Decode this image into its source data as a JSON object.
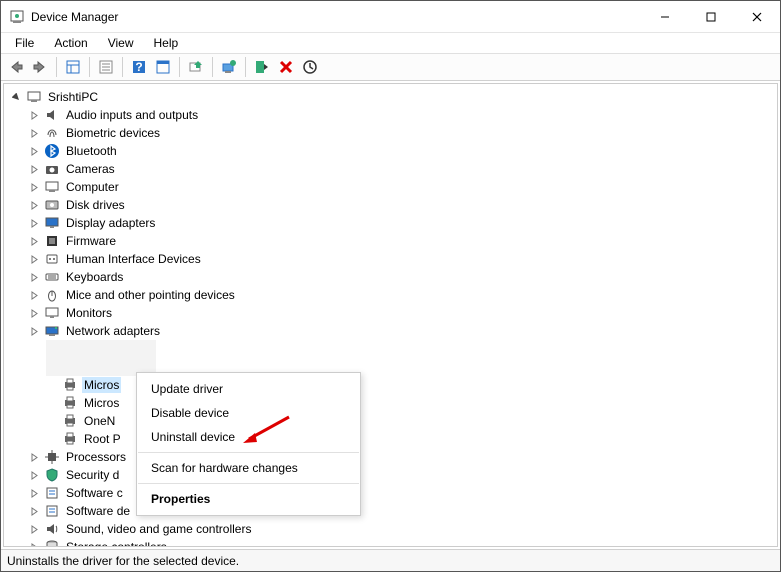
{
  "window": {
    "title": "Device Manager"
  },
  "menus": {
    "file": "File",
    "action": "Action",
    "view": "View",
    "help": "Help"
  },
  "root": {
    "name": "SrishtiPC"
  },
  "categories": [
    {
      "label": "Audio inputs and outputs",
      "icon": "speaker"
    },
    {
      "label": "Biometric devices",
      "icon": "fingerprint"
    },
    {
      "label": "Bluetooth",
      "icon": "bluetooth"
    },
    {
      "label": "Cameras",
      "icon": "camera"
    },
    {
      "label": "Computer",
      "icon": "computer"
    },
    {
      "label": "Disk drives",
      "icon": "disk"
    },
    {
      "label": "Display adapters",
      "icon": "display"
    },
    {
      "label": "Firmware",
      "icon": "firmware"
    },
    {
      "label": "Human Interface Devices",
      "icon": "hid"
    },
    {
      "label": "Keyboards",
      "icon": "keyboard"
    },
    {
      "label": "Mice and other pointing devices",
      "icon": "mouse"
    },
    {
      "label": "Monitors",
      "icon": "monitor"
    },
    {
      "label": "Network adapters",
      "icon": "network"
    }
  ],
  "printers": {
    "selected": {
      "label": "Micros"
    },
    "items": [
      {
        "label": "Micros"
      },
      {
        "label": "OneN"
      },
      {
        "label": "Root P"
      }
    ]
  },
  "categories2": [
    {
      "label": "Processors",
      "icon": "cpu"
    },
    {
      "label": "Security d",
      "icon": "security"
    },
    {
      "label": "Software c",
      "icon": "software"
    },
    {
      "label": "Software de",
      "icon": "software"
    },
    {
      "label": "Sound, video and game controllers",
      "icon": "sound"
    },
    {
      "label": "Storage controllers",
      "icon": "storage"
    }
  ],
  "context_menu": {
    "update": "Update driver",
    "disable": "Disable device",
    "uninstall": "Uninstall device",
    "scan": "Scan for hardware changes",
    "properties": "Properties"
  },
  "statusbar": {
    "text": "Uninstalls the driver for the selected device."
  }
}
